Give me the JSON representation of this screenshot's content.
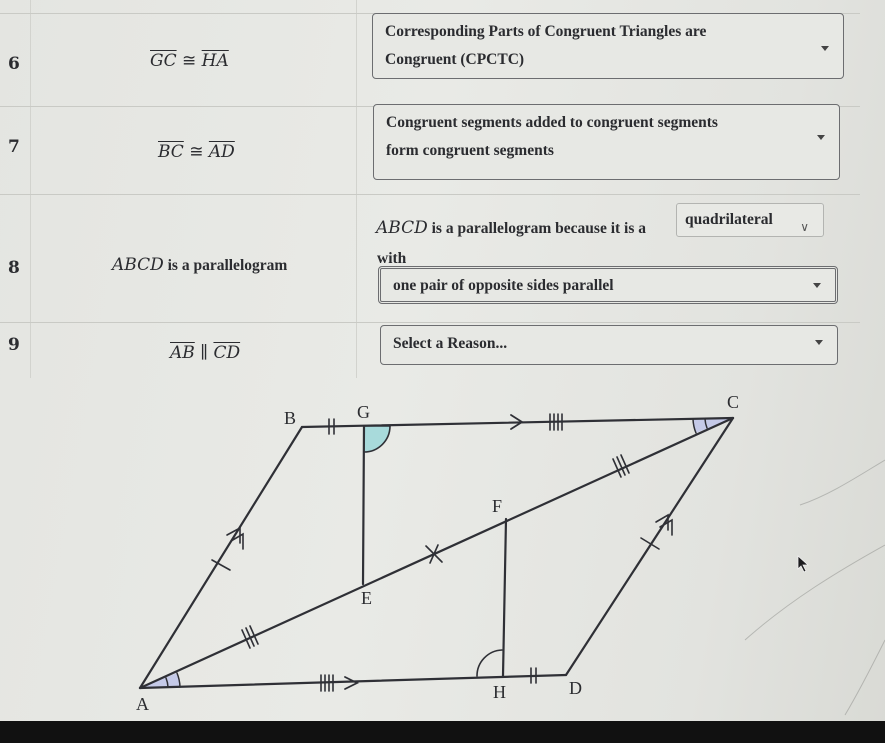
{
  "proof_rows": [
    {
      "number": "6",
      "statement": {
        "left": "GC",
        "relation": "≅",
        "right": "HA"
      },
      "reason": {
        "type": "dropdown",
        "line1": "Corresponding Parts of Congruent Triangles are",
        "line2": "Congruent (CPCTC)"
      }
    },
    {
      "number": "7",
      "statement": {
        "left": "BC",
        "relation": "≅",
        "right": "AD"
      },
      "reason": {
        "type": "dropdown",
        "line1": "Congruent segments added to congruent segments",
        "line2": "form congruent segments"
      }
    },
    {
      "number": "8",
      "statement": {
        "subject": "ABCD",
        "text": "is a parallelogram"
      },
      "reason": {
        "type": "sentence",
        "subject": "ABCD",
        "prefix": "is a parallelogram because it is a",
        "inline_select_value": "quadrilateral",
        "with_label": "with",
        "dropdown_value": "one pair of opposite sides parallel"
      }
    },
    {
      "number": "9",
      "statement": {
        "left": "AB",
        "relation": "∥",
        "right": "CD"
      },
      "reason": {
        "type": "dropdown",
        "placeholder": "Select a Reason..."
      }
    }
  ],
  "diagram": {
    "points": [
      "A",
      "B",
      "C",
      "D",
      "E",
      "F",
      "G",
      "H"
    ],
    "segments": [
      "AB",
      "BC",
      "CD",
      "DA",
      "AC",
      "GE",
      "FH"
    ],
    "markings": {
      "BG_HD": "double tick",
      "BC_AD": "quadruple tick with parallel arrow",
      "AE_FC": "triple tick",
      "AB_CD": "single tick with double parallel arrow",
      "EF_midpoint": "x mark",
      "angle_G": "right angle (teal)",
      "angle_H": "right angle",
      "angle_A_C": "double arc angle (lavender)"
    },
    "colors": {
      "right_angle_fill": "#a8dadb",
      "angle_fill": "#c5cae8",
      "stroke": "#2f3036"
    }
  },
  "icons": {
    "dropdown_caret": "caret-down-icon",
    "chevron": "chevron-down-icon",
    "cursor": "mouse-pointer-icon"
  }
}
